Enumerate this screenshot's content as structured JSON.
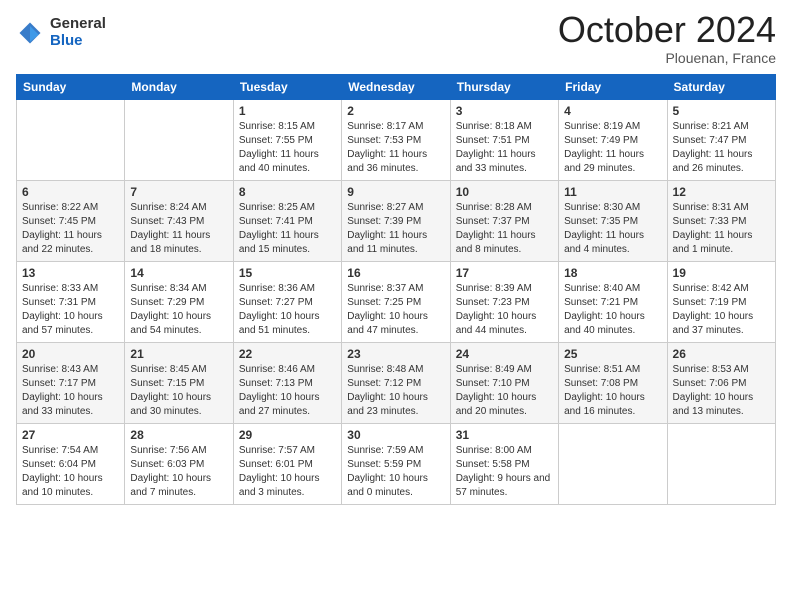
{
  "header": {
    "logo_general": "General",
    "logo_blue": "Blue",
    "month_title": "October 2024",
    "subtitle": "Plouenan, France"
  },
  "weekdays": [
    "Sunday",
    "Monday",
    "Tuesday",
    "Wednesday",
    "Thursday",
    "Friday",
    "Saturday"
  ],
  "weeks": [
    [
      {
        "day": "",
        "info": ""
      },
      {
        "day": "",
        "info": ""
      },
      {
        "day": "1",
        "info": "Sunrise: 8:15 AM\nSunset: 7:55 PM\nDaylight: 11 hours and 40 minutes."
      },
      {
        "day": "2",
        "info": "Sunrise: 8:17 AM\nSunset: 7:53 PM\nDaylight: 11 hours and 36 minutes."
      },
      {
        "day": "3",
        "info": "Sunrise: 8:18 AM\nSunset: 7:51 PM\nDaylight: 11 hours and 33 minutes."
      },
      {
        "day": "4",
        "info": "Sunrise: 8:19 AM\nSunset: 7:49 PM\nDaylight: 11 hours and 29 minutes."
      },
      {
        "day": "5",
        "info": "Sunrise: 8:21 AM\nSunset: 7:47 PM\nDaylight: 11 hours and 26 minutes."
      }
    ],
    [
      {
        "day": "6",
        "info": "Sunrise: 8:22 AM\nSunset: 7:45 PM\nDaylight: 11 hours and 22 minutes."
      },
      {
        "day": "7",
        "info": "Sunrise: 8:24 AM\nSunset: 7:43 PM\nDaylight: 11 hours and 18 minutes."
      },
      {
        "day": "8",
        "info": "Sunrise: 8:25 AM\nSunset: 7:41 PM\nDaylight: 11 hours and 15 minutes."
      },
      {
        "day": "9",
        "info": "Sunrise: 8:27 AM\nSunset: 7:39 PM\nDaylight: 11 hours and 11 minutes."
      },
      {
        "day": "10",
        "info": "Sunrise: 8:28 AM\nSunset: 7:37 PM\nDaylight: 11 hours and 8 minutes."
      },
      {
        "day": "11",
        "info": "Sunrise: 8:30 AM\nSunset: 7:35 PM\nDaylight: 11 hours and 4 minutes."
      },
      {
        "day": "12",
        "info": "Sunrise: 8:31 AM\nSunset: 7:33 PM\nDaylight: 11 hours and 1 minute."
      }
    ],
    [
      {
        "day": "13",
        "info": "Sunrise: 8:33 AM\nSunset: 7:31 PM\nDaylight: 10 hours and 57 minutes."
      },
      {
        "day": "14",
        "info": "Sunrise: 8:34 AM\nSunset: 7:29 PM\nDaylight: 10 hours and 54 minutes."
      },
      {
        "day": "15",
        "info": "Sunrise: 8:36 AM\nSunset: 7:27 PM\nDaylight: 10 hours and 51 minutes."
      },
      {
        "day": "16",
        "info": "Sunrise: 8:37 AM\nSunset: 7:25 PM\nDaylight: 10 hours and 47 minutes."
      },
      {
        "day": "17",
        "info": "Sunrise: 8:39 AM\nSunset: 7:23 PM\nDaylight: 10 hours and 44 minutes."
      },
      {
        "day": "18",
        "info": "Sunrise: 8:40 AM\nSunset: 7:21 PM\nDaylight: 10 hours and 40 minutes."
      },
      {
        "day": "19",
        "info": "Sunrise: 8:42 AM\nSunset: 7:19 PM\nDaylight: 10 hours and 37 minutes."
      }
    ],
    [
      {
        "day": "20",
        "info": "Sunrise: 8:43 AM\nSunset: 7:17 PM\nDaylight: 10 hours and 33 minutes."
      },
      {
        "day": "21",
        "info": "Sunrise: 8:45 AM\nSunset: 7:15 PM\nDaylight: 10 hours and 30 minutes."
      },
      {
        "day": "22",
        "info": "Sunrise: 8:46 AM\nSunset: 7:13 PM\nDaylight: 10 hours and 27 minutes."
      },
      {
        "day": "23",
        "info": "Sunrise: 8:48 AM\nSunset: 7:12 PM\nDaylight: 10 hours and 23 minutes."
      },
      {
        "day": "24",
        "info": "Sunrise: 8:49 AM\nSunset: 7:10 PM\nDaylight: 10 hours and 20 minutes."
      },
      {
        "day": "25",
        "info": "Sunrise: 8:51 AM\nSunset: 7:08 PM\nDaylight: 10 hours and 16 minutes."
      },
      {
        "day": "26",
        "info": "Sunrise: 8:53 AM\nSunset: 7:06 PM\nDaylight: 10 hours and 13 minutes."
      }
    ],
    [
      {
        "day": "27",
        "info": "Sunrise: 7:54 AM\nSunset: 6:04 PM\nDaylight: 10 hours and 10 minutes."
      },
      {
        "day": "28",
        "info": "Sunrise: 7:56 AM\nSunset: 6:03 PM\nDaylight: 10 hours and 7 minutes."
      },
      {
        "day": "29",
        "info": "Sunrise: 7:57 AM\nSunset: 6:01 PM\nDaylight: 10 hours and 3 minutes."
      },
      {
        "day": "30",
        "info": "Sunrise: 7:59 AM\nSunset: 5:59 PM\nDaylight: 10 hours and 0 minutes."
      },
      {
        "day": "31",
        "info": "Sunrise: 8:00 AM\nSunset: 5:58 PM\nDaylight: 9 hours and 57 minutes."
      },
      {
        "day": "",
        "info": ""
      },
      {
        "day": "",
        "info": ""
      }
    ]
  ]
}
